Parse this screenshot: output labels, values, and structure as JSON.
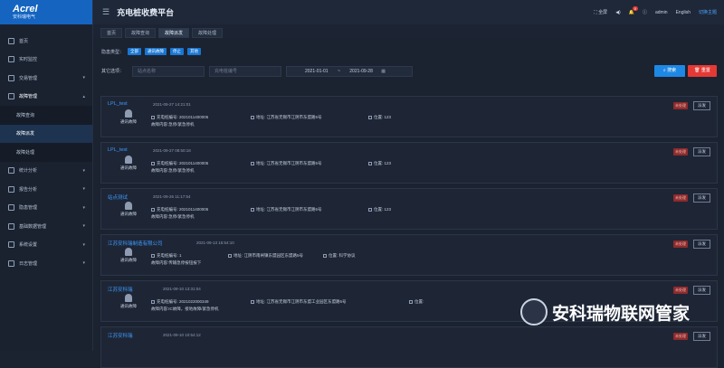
{
  "app": {
    "logo": "Acrel",
    "logo_sub": "安科瑞电气",
    "title": "充电桩收费平台"
  },
  "topbar": {
    "fullscreen": "全屏",
    "notif_count": "0",
    "user": "admin",
    "lang": "English",
    "theme": "切换主题"
  },
  "sidebar": {
    "items": [
      {
        "label": "首页"
      },
      {
        "label": "实时监控"
      },
      {
        "label": "交易管理"
      },
      {
        "label": "故障管理"
      },
      {
        "label": "统计分析"
      },
      {
        "label": "报告分析"
      },
      {
        "label": "隐患管理"
      },
      {
        "label": "基础数据管理"
      },
      {
        "label": "系统设置"
      },
      {
        "label": "日志管理"
      }
    ],
    "sub": [
      {
        "label": "故障查询"
      },
      {
        "label": "故障派发"
      },
      {
        "label": "故障处理"
      }
    ]
  },
  "tabs": [
    {
      "label": "首页"
    },
    {
      "label": "故障查询"
    },
    {
      "label": "故障派发"
    },
    {
      "label": "故障处理"
    }
  ],
  "filter": {
    "type_label": "隐患类型：",
    "chips": [
      "全部",
      "通讯故障",
      "停止",
      "其他"
    ],
    "other_label": "其它选项：",
    "site_ph": "站点名称",
    "pile_ph": "充电桩编号",
    "date_from": "2021-01-01",
    "sep": "~",
    "date_to": "2021-09-28",
    "search": "搜索",
    "reset": "重置"
  },
  "cards": [
    {
      "name": "LPL_test",
      "time": "2021-09-27 14:21:01",
      "type": "通讯故障",
      "pile_label": "充电桩编号:",
      "pile": "2021011400005",
      "addr_label": "地址:",
      "addr": "江苏省无锡市江阴市东盟路5号",
      "pos_label": "位置:",
      "pos": "123",
      "content": "故障内容:急停/紧急停机",
      "status": "未处理",
      "dispatch": "派发"
    },
    {
      "name": "LPL_test",
      "time": "2021-09-27 08:50:18",
      "type": "通讯故障",
      "pile_label": "充电桩编号:",
      "pile": "2021011400005",
      "addr_label": "地址:",
      "addr": "江苏省无锡市江阴市东盟路5号",
      "pos_label": "位置:",
      "pos": "123",
      "content": "故障内容:急停/紧急停机",
      "status": "未处理",
      "dispatch": "派发"
    },
    {
      "name": "站点测试",
      "time": "2021-09-26 11:17:54",
      "type": "通讯故障",
      "pile_label": "充电桩编号:",
      "pile": "2021011400005",
      "addr_label": "地址:",
      "addr": "江苏省无锡市江阴市东盟路5号",
      "pos_label": "位置:",
      "pos": "123",
      "content": "故障内容:急停/紧急停机",
      "status": "未处理",
      "dispatch": "派发"
    },
    {
      "name": "江苏安科瑞制造有限公司",
      "time": "2021-09-13 15:54:10",
      "type": "通讯故障",
      "pile_label": "充电桩编号:",
      "pile": "1",
      "addr_label": "地址:",
      "addr": "江阴市南闸镇东盟园区东盟路5号",
      "pos_label": "位置:",
      "pos": "科学协议",
      "content": "故障内容:传输急停按钮按下",
      "status": "未处理",
      "dispatch": "派发"
    },
    {
      "name": "江苏安科瑞",
      "time": "2021-09-10 13:31:04",
      "type": "通讯故障",
      "pile_label": "充电桩编号:",
      "pile": "2021022000349",
      "addr_label": "地址:",
      "addr": "江苏省无锡市江阴市东盟工业园区东盟路5号",
      "pos_label": "位置:",
      "pos": "",
      "content": "故障内容:IC故障，接地故障/紧急停机",
      "status": "未处理",
      "dispatch": "派发"
    },
    {
      "name": "江苏安科瑞",
      "time": "2021-09-10 10:54:12",
      "type": "",
      "pile_label": "",
      "pile": "",
      "addr_label": "",
      "addr": "",
      "pos_label": "",
      "pos": "",
      "content": "",
      "status": "未处理",
      "dispatch": "派发"
    }
  ],
  "watermark": "安科瑞物联网管家"
}
